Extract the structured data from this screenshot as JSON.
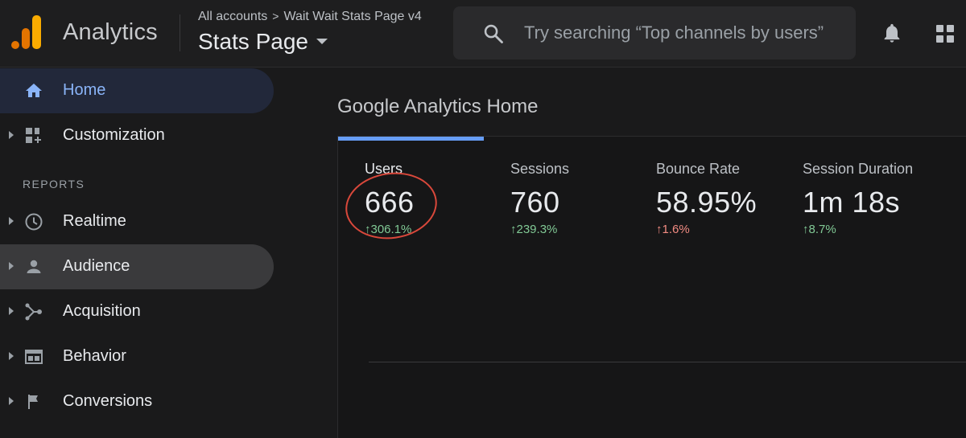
{
  "header": {
    "app_name": "Analytics",
    "breadcrumb": {
      "account": "All accounts",
      "separator": ">",
      "property": "Wait Wait Stats Page v4"
    },
    "view_title": "Stats Page",
    "search_placeholder": "Try searching “Top channels by users”"
  },
  "sidebar": {
    "items_top": [
      {
        "label": "Home",
        "icon": "home-icon"
      },
      {
        "label": "Customization",
        "icon": "customization-icon"
      }
    ],
    "reports_header": "REPORTS",
    "reports": [
      {
        "label": "Realtime",
        "icon": "clock-icon"
      },
      {
        "label": "Audience",
        "icon": "person-icon"
      },
      {
        "label": "Acquisition",
        "icon": "acquisition-icon"
      },
      {
        "label": "Behavior",
        "icon": "behavior-icon"
      },
      {
        "label": "Conversions",
        "icon": "flag-icon"
      }
    ]
  },
  "main": {
    "title": "Google Analytics Home",
    "metrics": [
      {
        "label": "Users",
        "value": "666",
        "change": "↑306.1%"
      },
      {
        "label": "Sessions",
        "value": "760",
        "change": "↑239.3%"
      },
      {
        "label": "Bounce Rate",
        "value": "58.95%",
        "change": "↑1.6%"
      },
      {
        "label": "Session Duration",
        "value": "1m 18s",
        "change": "↑8.7%"
      }
    ]
  },
  "colors": {
    "accent_blue": "#8ab4f8",
    "tab_indicator": "#669df6",
    "positive": "#81c995",
    "negative": "#f28b82",
    "annotation_circle": "#d9483b",
    "logo_orange": "#e37400",
    "logo_yellow": "#f9ab00"
  }
}
